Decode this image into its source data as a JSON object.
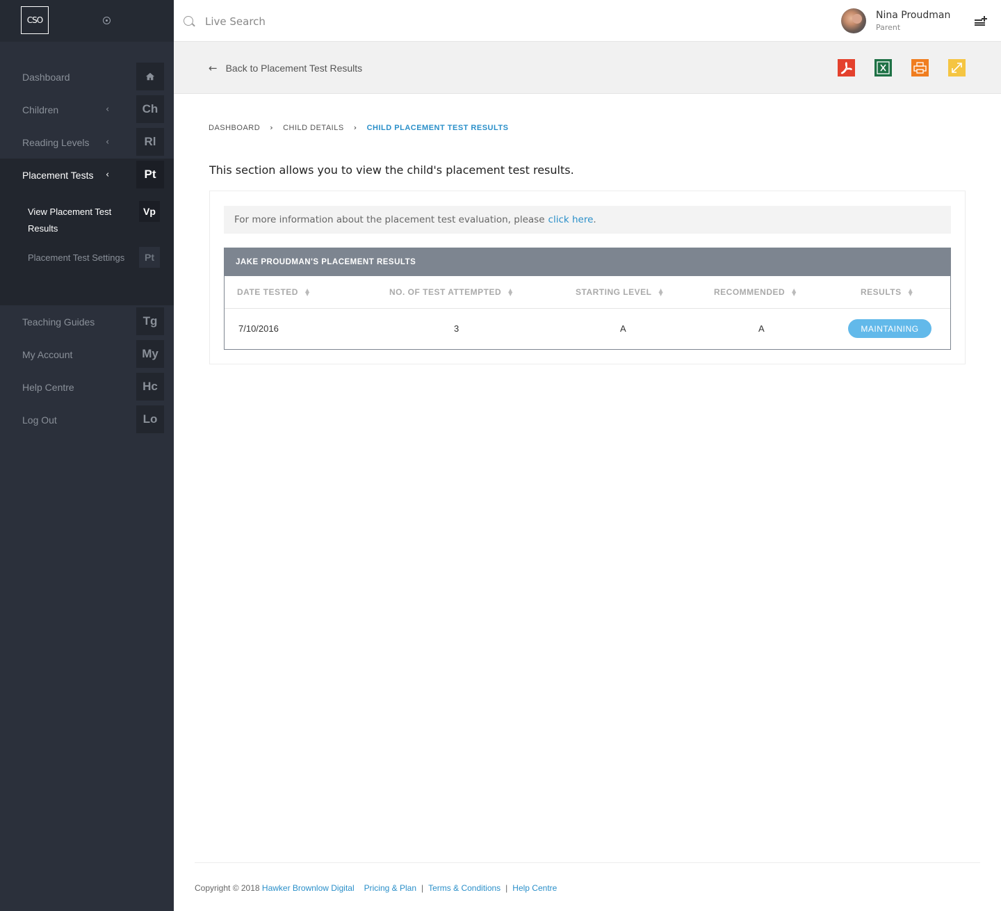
{
  "sidebar": {
    "logo": "CSO",
    "items": [
      {
        "label": "Dashboard",
        "badge": "",
        "icon": "home-icon",
        "chevron": false
      },
      {
        "label": "Children",
        "badge": "Ch",
        "chevron": true
      },
      {
        "label": "Reading Levels",
        "badge": "Rl",
        "chevron": true
      },
      {
        "label": "Placement Tests",
        "badge": "Pt",
        "chevron": true,
        "active": true
      }
    ],
    "subitems": [
      {
        "label": "View Placement Test Results",
        "badge": "Vp",
        "active": true
      },
      {
        "label": "Placement Test Settings",
        "badge": "Pt",
        "active": false
      }
    ],
    "items_after": [
      {
        "label": "Teaching Guides",
        "badge": "Tg"
      },
      {
        "label": "My Account",
        "badge": "My"
      },
      {
        "label": "Help Centre",
        "badge": "Hc"
      },
      {
        "label": "Log Out",
        "badge": "Lo"
      }
    ]
  },
  "header": {
    "search_placeholder": "Live Search",
    "user_name": "Nina Proudman",
    "user_role": "Parent"
  },
  "subheader": {
    "back_label": "Back to Placement Test Results",
    "exports": [
      "pdf-icon",
      "excel-icon",
      "print-icon",
      "expand-icon"
    ]
  },
  "breadcrumb": [
    "DASHBOARD",
    "CHILD DETAILS",
    "CHILD PLACEMENT TEST RESULTS"
  ],
  "intro": "This section allows you to view the child's placement test results.",
  "info": {
    "text": "For more information about the placement test evaluation, please",
    "link": "click here",
    "suffix": "."
  },
  "results": {
    "title": "JAKE PROUDMAN'S PLACEMENT RESULTS",
    "columns": [
      "DATE TESTED",
      "NO. OF TEST ATTEMPTED",
      "STARTING LEVEL",
      "RECOMMENDED",
      "RESULTS"
    ],
    "rows": [
      {
        "date": "7/10/2016",
        "attempts": "3",
        "starting": "A",
        "recommended": "A",
        "result": "MAINTAINING"
      }
    ]
  },
  "footer": {
    "copyright": "Copyright © 2018",
    "company": "Hawker Brownlow Digital",
    "links": [
      "Pricing & Plan",
      "Terms & Conditions",
      "Help Centre"
    ]
  },
  "colors": {
    "sidebar_bg": "#2b303b",
    "accent": "#2a8fc9",
    "pill": "#62b9ea",
    "pdf": "#e4412d",
    "excel": "#1e7145",
    "print": "#f07d1f",
    "expand": "#f5c542"
  }
}
